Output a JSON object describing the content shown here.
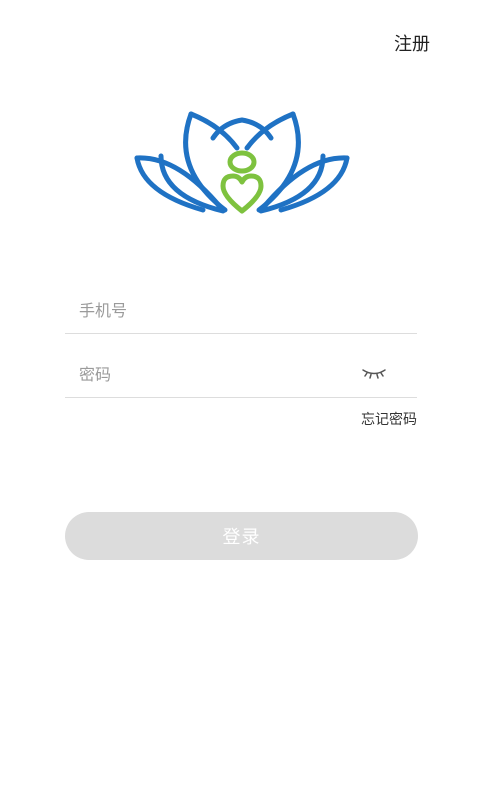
{
  "header": {
    "register_label": "注册"
  },
  "logo": {
    "icon": "lotus-person-heart-logo",
    "colors": {
      "petal_blue": "#1f72c4",
      "figure_green": "#7ec23f"
    }
  },
  "form": {
    "phone_placeholder": "手机号",
    "password_placeholder": "密码",
    "password_toggle_icon": "eye-closed-icon",
    "forgot_password_label": "忘记密码",
    "login_label": "登录"
  },
  "colors": {
    "login_button_bg": "#dcdcdc",
    "login_button_text": "#ffffff",
    "divider": "#dddddd"
  }
}
